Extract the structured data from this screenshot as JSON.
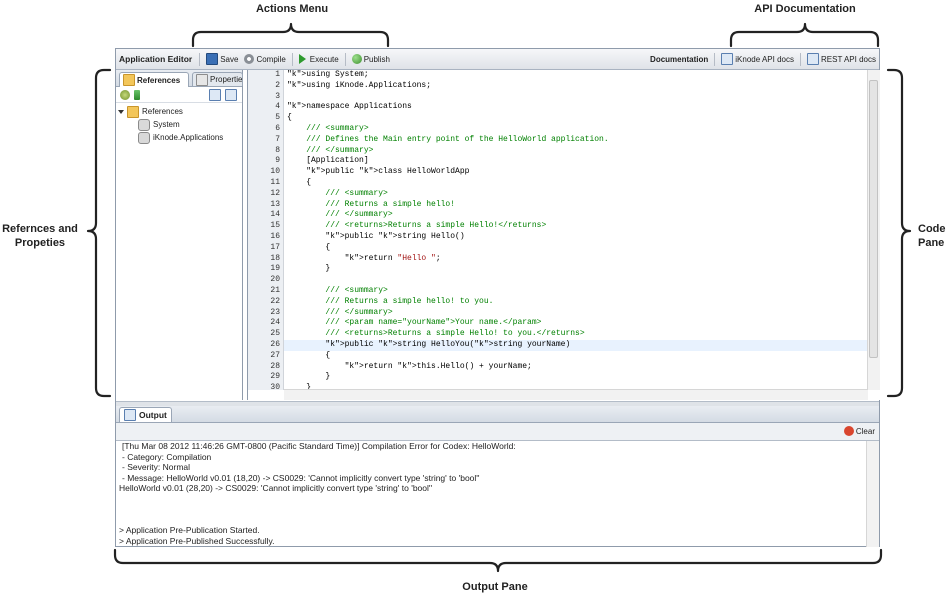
{
  "annotations": {
    "actions_menu": "Actions Menu",
    "api_documentation": "API Documentation",
    "references_properties_line1": "Refernces and",
    "references_properties_line2": "Propeties",
    "code_pane_line1": "Code",
    "code_pane_line2": "Pane",
    "output_pane": "Output Pane"
  },
  "toolbar": {
    "title": "Application Editor",
    "save": "Save",
    "compile": "Compile",
    "execute": "Execute",
    "publish": "Publish",
    "documentation": "Documentation",
    "iknode_docs": "iKnode API docs",
    "rest_docs": "REST API docs"
  },
  "left_panel": {
    "tabs": [
      "References",
      "Properties"
    ],
    "tree": {
      "root": "References",
      "children": [
        "System",
        "iKnode.Applications"
      ]
    }
  },
  "code": {
    "lines": [
      "using System;",
      "using iKnode.Applications;",
      "",
      "namespace Applications",
      "{",
      "    /// <summary>",
      "    /// Defines the Main entry point of the HelloWorld application.",
      "    /// </summary>",
      "    [Application]",
      "    public class HelloWorldApp",
      "    {",
      "        /// <summary>",
      "        /// Returns a simple hello!",
      "        /// </summary>",
      "        /// <returns>Returns a simple Hello!</returns>",
      "        public string Hello()",
      "        {",
      "            return \"Hello \";",
      "        }",
      "",
      "        /// <summary>",
      "        /// Returns a simple hello! to you.",
      "        /// </summary>",
      "        /// <param name=\"yourName\">Your name.</param>",
      "        /// <returns>Returns a simple Hello! to you.</returns>",
      "        public string HelloYou(string yourName)",
      "        {",
      "            return this.Hello() + yourName;",
      "        }",
      "    }",
      ""
    ],
    "highlighted_line": 26
  },
  "output": {
    "tab_label": "Output",
    "clear_label": "Clear",
    "lines": [
      "[Thu Mar 08 2012 11:46:26 GMT-0800 (Pacific Standard Time)] Compilation Error for Codex: HelloWorld:",
      "- Category: Compilation",
      "- Severity: Normal",
      "- Message: HelloWorld v0.01 (18,20) -> CS0029: 'Cannot implicitly convert type 'string' to 'bool''",
      "HelloWorld v0.01 (28,20) -> CS0029: 'Cannot implicitly convert type 'string' to 'bool''",
      "",
      "",
      "",
      "> Application Pre-Publication Started.",
      "> Application Pre-Published Successfully."
    ]
  },
  "colors": {
    "keyword": "#0000ff",
    "comment": "#008000",
    "string": "#a31515",
    "highlight": "#e8f2fe",
    "clear_icon": "#d9462f"
  }
}
